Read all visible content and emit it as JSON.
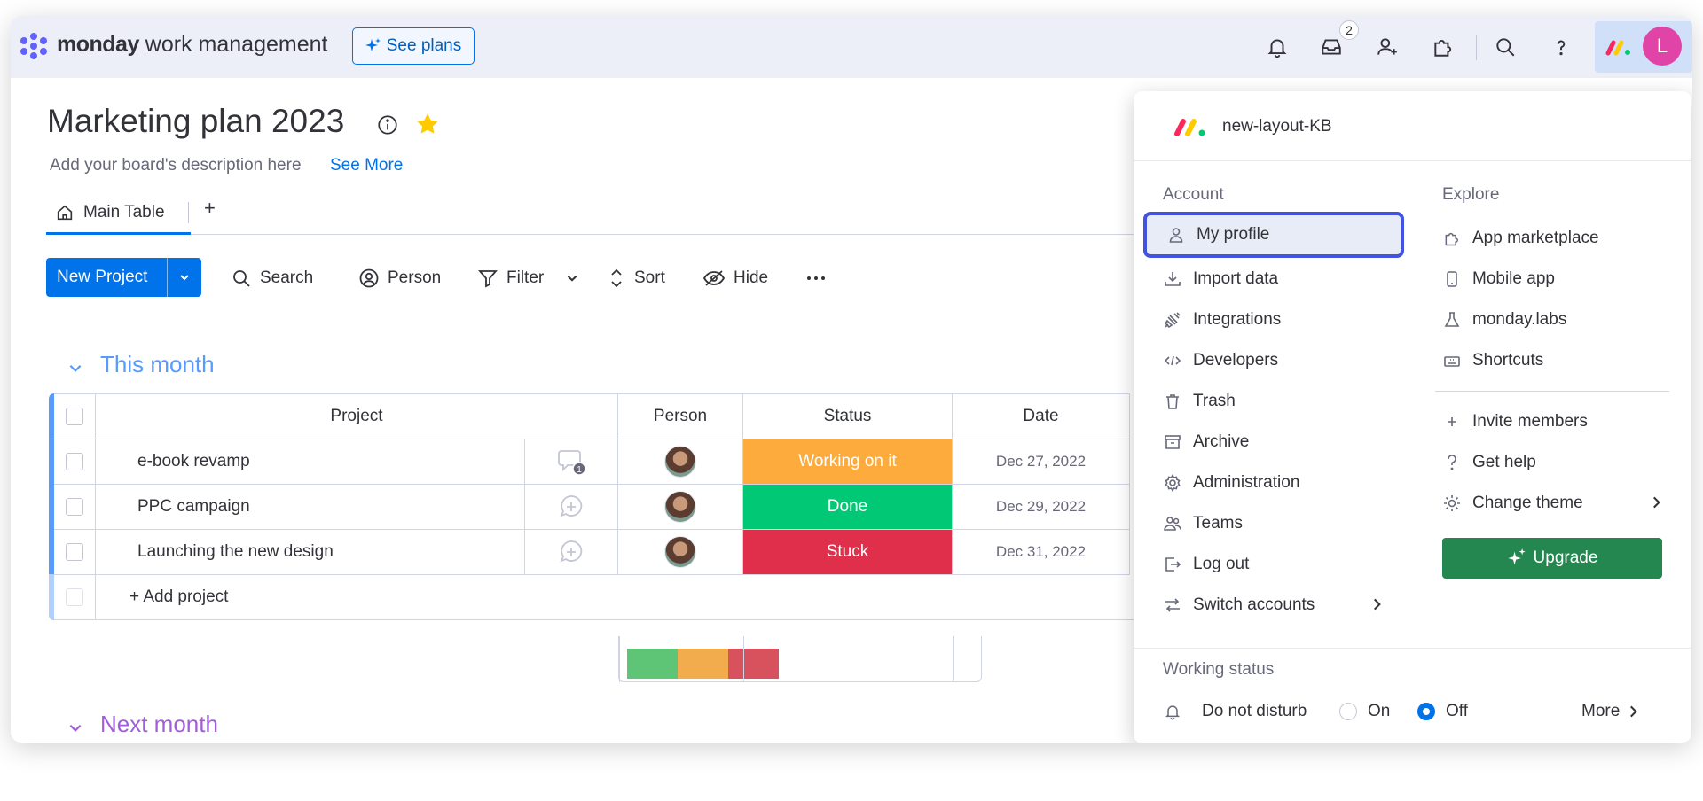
{
  "topbar": {
    "brand_bold": "monday",
    "brand_rest": " work management",
    "see_plans": "See plans",
    "inbox_count": "2",
    "avatar_letter": "L"
  },
  "board": {
    "title": "Marketing plan 2023",
    "description": "Add your board's description here",
    "see_more": "See More",
    "tab_main": "Main Table",
    "tab_add": "+"
  },
  "toolbar": {
    "new_project": "New Project",
    "search": "Search",
    "person": "Person",
    "filter": "Filter",
    "sort": "Sort",
    "hide": "Hide"
  },
  "group1": {
    "title": "This month",
    "columns": [
      "Project",
      "Person",
      "Status",
      "Date"
    ],
    "rows": [
      {
        "project": "e-book revamp",
        "status": "Working on it",
        "status_color": "#fdab3d",
        "date": "Dec 27, 2022",
        "updates": "1"
      },
      {
        "project": "PPC campaign",
        "status": "Done",
        "status_color": "#00c875",
        "date": "Dec 29, 2022"
      },
      {
        "project": "Launching the new design",
        "status": "Stuck",
        "status_color": "#df2f4a",
        "date": "Dec 31, 2022"
      }
    ],
    "add_project": "+ Add project",
    "summary": [
      {
        "color": "#5ec576",
        "fraction": 0.3333
      },
      {
        "color": "#f2ac4d",
        "fraction": 0.3333
      },
      {
        "color": "#d8525e",
        "fraction": 0.3334
      }
    ]
  },
  "group2": {
    "title": "Next month"
  },
  "menu": {
    "account_name": "new-layout-KB",
    "account_title": "Account",
    "explore_title": "Explore",
    "account_items": [
      "My profile",
      "Import data",
      "Integrations",
      "Developers",
      "Trash",
      "Archive",
      "Administration",
      "Teams",
      "Log out",
      "Switch accounts"
    ],
    "explore_items": [
      "App marketplace",
      "Mobile app",
      "monday.labs",
      "Shortcuts"
    ],
    "extra_items": [
      "Invite members",
      "Get help",
      "Change theme"
    ],
    "upgrade": "Upgrade",
    "working_status_title": "Working status",
    "do_not_disturb": "Do not disturb",
    "on": "On",
    "off": "Off",
    "more": "More"
  },
  "colors": {
    "primary": "#0073ea",
    "selected_border": "#4353e1",
    "upgrade": "#258750"
  }
}
